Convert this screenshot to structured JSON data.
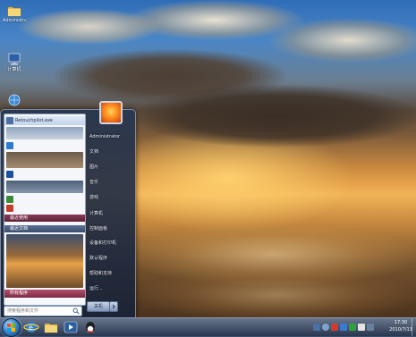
{
  "desktop": {
    "icons": [
      {
        "label": "Administra...",
        "icon": "folder-icon"
      },
      {
        "label": "计算机",
        "icon": "computer-icon"
      },
      {
        "label": "",
        "icon": "network-icon"
      }
    ]
  },
  "start_menu": {
    "programs": [
      {
        "label": "Retouchpilot.exe",
        "color": "#4c6fa3"
      },
      {
        "label": "",
        "color": "#a8b6c8"
      },
      {
        "label": "",
        "color": "#2b7bd0"
      },
      {
        "label": "",
        "color": "#1f4f9a"
      },
      {
        "label": "",
        "color": "#3a8a3a"
      },
      {
        "label": "",
        "color": "#c43c2a"
      },
      {
        "label": "",
        "color": "#5a6f92"
      },
      {
        "label": "",
        "color": "#d58a2a"
      }
    ],
    "section_label": "最近使用",
    "section_label_2": "最近文档",
    "all_programs": "所有程序",
    "search_placeholder": "搜索程序和文件",
    "right_items": [
      "Administrator",
      "文档",
      "图片",
      "音乐",
      "游戏",
      "计算机",
      "控制面板",
      "设备和打印机",
      "默认程序",
      "帮助和支持",
      "运行..."
    ],
    "shutdown_label": "关机"
  },
  "taskbar": {
    "pinned": [
      "ie-icon",
      "explorer-icon",
      "media-player-icon",
      "qq-icon",
      "desktop-icon"
    ],
    "clock_time": "17:30",
    "clock_date": "2010/7/13"
  }
}
